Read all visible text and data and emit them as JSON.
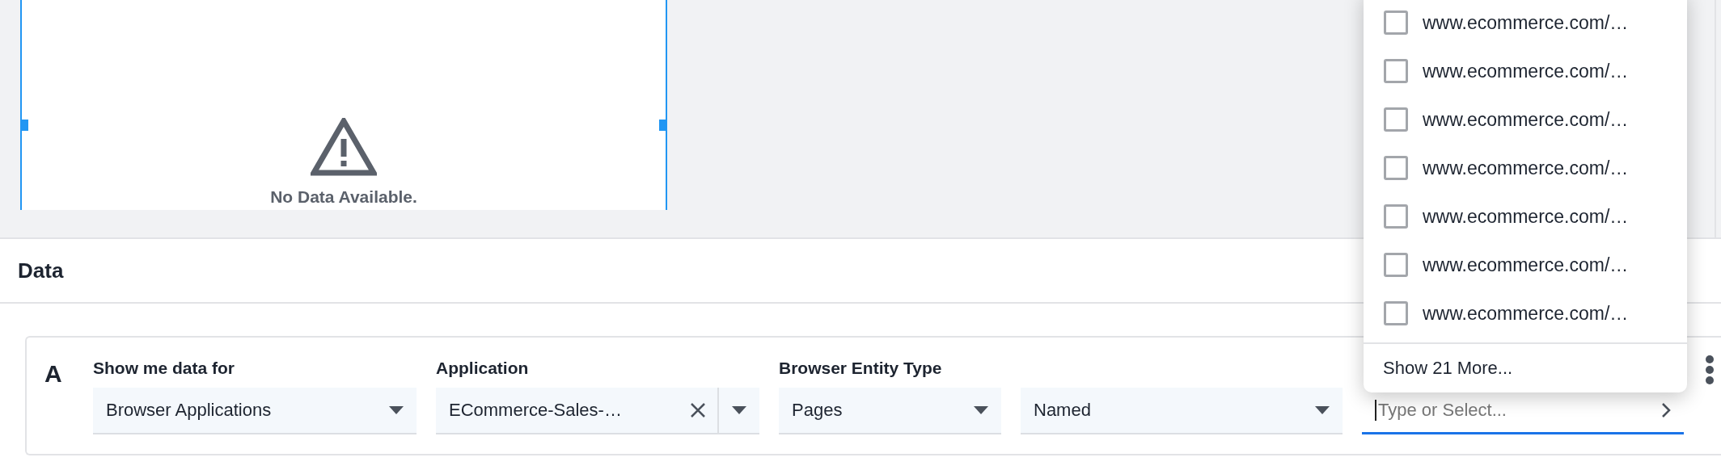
{
  "chart_panel": {
    "selected": true,
    "message": "No Data Available."
  },
  "data_section": {
    "title": "Data"
  },
  "query": {
    "letter": "A",
    "fields": [
      {
        "kind": "select",
        "label": "Show me data for",
        "value": "Browser Applications"
      },
      {
        "kind": "clearable",
        "label": "Application",
        "value": "ECommerce-Sales-…"
      },
      {
        "kind": "select",
        "label": "Browser Entity Type",
        "value": "Pages"
      },
      {
        "kind": "select",
        "value": "Named"
      },
      {
        "kind": "combo",
        "placeholder": "Type or Select...",
        "focused": true
      }
    ]
  },
  "dropdown": {
    "options": [
      {
        "label": "www.ecommerce.com/…",
        "checked": false
      },
      {
        "label": "www.ecommerce.com/…",
        "checked": false
      },
      {
        "label": "www.ecommerce.com/…",
        "checked": false
      },
      {
        "label": "www.ecommerce.com/…",
        "checked": false
      },
      {
        "label": "www.ecommerce.com/…",
        "checked": false
      },
      {
        "label": "www.ecommerce.com/…",
        "checked": false
      },
      {
        "label": "www.ecommerce.com/…",
        "checked": false
      }
    ],
    "more": "Show 21 More..."
  }
}
